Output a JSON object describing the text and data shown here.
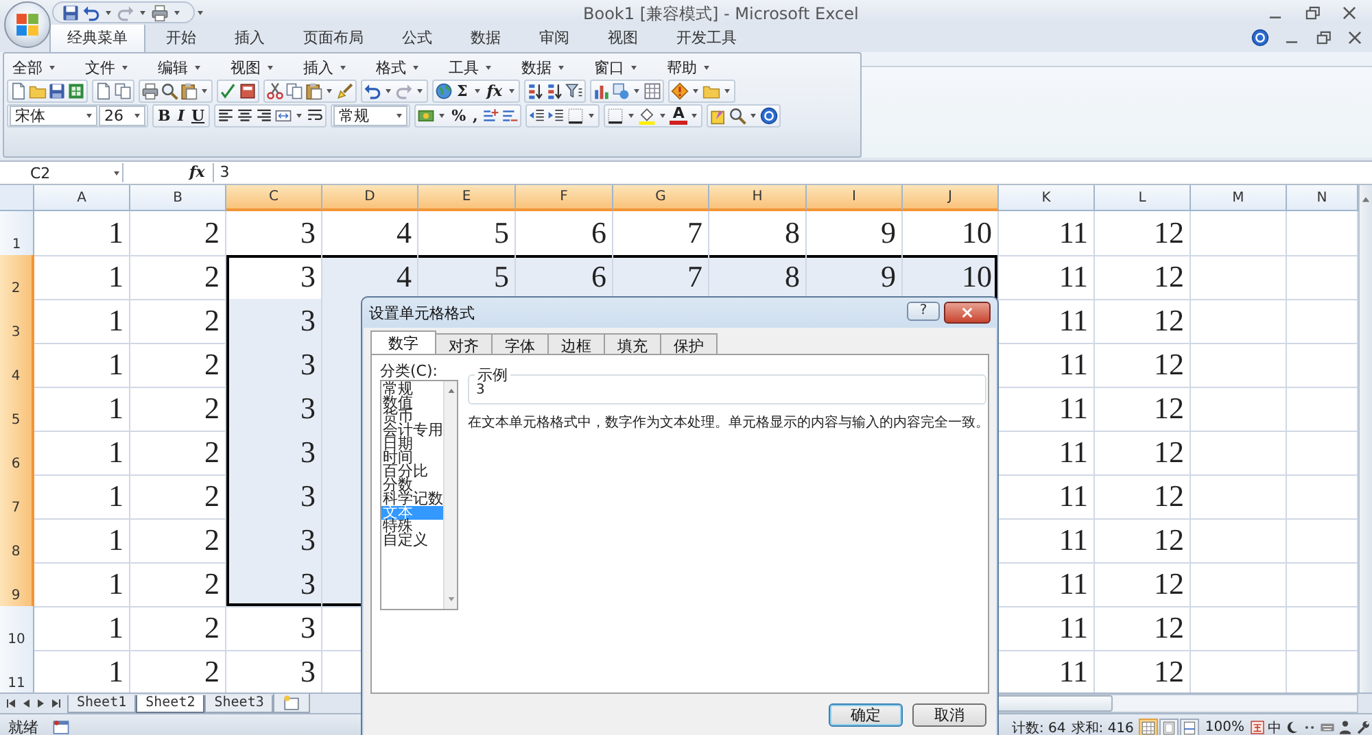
{
  "window": {
    "title": "Book1  [兼容模式] - Microsoft Excel"
  },
  "ribbon_tabs": [
    {
      "label": "经典菜单",
      "selected": true
    },
    {
      "label": "开始",
      "selected": false
    },
    {
      "label": "插入",
      "selected": false
    },
    {
      "label": "页面布局",
      "selected": false
    },
    {
      "label": "公式",
      "selected": false
    },
    {
      "label": "数据",
      "selected": false
    },
    {
      "label": "审阅",
      "selected": false
    },
    {
      "label": "视图",
      "selected": false
    },
    {
      "label": "开发工具",
      "selected": false
    }
  ],
  "classic_menus": [
    "全部",
    "文件",
    "编辑",
    "视图",
    "插入",
    "格式",
    "工具",
    "数据",
    "窗口",
    "帮助"
  ],
  "toolbar": {
    "sum": "Σ",
    "fx": "fx",
    "font": "宋体",
    "size": "26",
    "bold": "B",
    "italic": "I",
    "underline": "U",
    "number_format": "常规",
    "percent": "%",
    "comma": ",",
    "font_color": "A"
  },
  "formula_bar": {
    "name_box": "C2",
    "fx": "fx",
    "value": "3"
  },
  "sheet": {
    "columns": [
      {
        "label": "A",
        "selected": false
      },
      {
        "label": "B",
        "selected": false
      },
      {
        "label": "C",
        "selected": true
      },
      {
        "label": "D",
        "selected": true
      },
      {
        "label": "E",
        "selected": true
      },
      {
        "label": "F",
        "selected": true
      },
      {
        "label": "G",
        "selected": true
      },
      {
        "label": "H",
        "selected": true
      },
      {
        "label": "I",
        "selected": true
      },
      {
        "label": "J",
        "selected": true
      },
      {
        "label": "K",
        "selected": false
      },
      {
        "label": "L",
        "selected": false
      },
      {
        "label": "M",
        "selected": false
      },
      {
        "label": "N",
        "selected": false
      }
    ],
    "rows": [
      {
        "label": "1",
        "selected": false,
        "cells": [
          "1",
          "2",
          "3",
          "4",
          "5",
          "6",
          "7",
          "8",
          "9",
          "10",
          "11",
          "12",
          null,
          null
        ]
      },
      {
        "label": "2",
        "selected": true,
        "cells": [
          "1",
          "2",
          "3",
          "4",
          "5",
          "6",
          "7",
          "8",
          "9",
          "10",
          "11",
          "12",
          null,
          null
        ]
      },
      {
        "label": "3",
        "selected": true,
        "cells": [
          "1",
          "2",
          "3",
          null,
          null,
          null,
          null,
          null,
          null,
          null,
          "11",
          "12",
          null,
          null
        ]
      },
      {
        "label": "4",
        "selected": true,
        "cells": [
          "1",
          "2",
          "3",
          null,
          null,
          null,
          null,
          null,
          null,
          null,
          "11",
          "12",
          null,
          null
        ]
      },
      {
        "label": "5",
        "selected": true,
        "cells": [
          "1",
          "2",
          "3",
          null,
          null,
          null,
          null,
          null,
          null,
          null,
          "11",
          "12",
          null,
          null
        ]
      },
      {
        "label": "6",
        "selected": true,
        "cells": [
          "1",
          "2",
          "3",
          null,
          null,
          null,
          null,
          null,
          null,
          null,
          "11",
          "12",
          null,
          null
        ]
      },
      {
        "label": "7",
        "selected": true,
        "cells": [
          "1",
          "2",
          "3",
          null,
          null,
          null,
          null,
          null,
          null,
          null,
          "11",
          "12",
          null,
          null
        ]
      },
      {
        "label": "8",
        "selected": true,
        "cells": [
          "1",
          "2",
          "3",
          null,
          null,
          null,
          null,
          null,
          null,
          null,
          "11",
          "12",
          null,
          null
        ]
      },
      {
        "label": "9",
        "selected": true,
        "cells": [
          "1",
          "2",
          "3",
          null,
          null,
          null,
          null,
          null,
          null,
          null,
          "11",
          "12",
          null,
          null
        ]
      },
      {
        "label": "10",
        "selected": false,
        "cells": [
          "1",
          "2",
          "3",
          null,
          null,
          null,
          null,
          null,
          null,
          null,
          "11",
          "12",
          null,
          null
        ]
      },
      {
        "label": "11",
        "selected": false,
        "cells": [
          "1",
          "2",
          "3",
          null,
          null,
          null,
          null,
          null,
          null,
          null,
          "11",
          "12",
          null,
          null
        ]
      }
    ]
  },
  "sheet_tabs": [
    {
      "label": "Sheet1",
      "selected": false
    },
    {
      "label": "Sheet2",
      "selected": true
    },
    {
      "label": "Sheet3",
      "selected": false
    }
  ],
  "status_bar": {
    "state": "就绪",
    "count": "计数: 64",
    "sum": "求和: 416",
    "views": [
      {
        "selected": true
      },
      {
        "selected": false
      },
      {
        "selected": false
      }
    ],
    "zoom": "100%",
    "ime": "中"
  },
  "dialog": {
    "title": "设置单元格格式",
    "help": "?",
    "tabs": [
      {
        "label": "数字",
        "selected": true
      },
      {
        "label": "对齐",
        "selected": false
      },
      {
        "label": "字体",
        "selected": false
      },
      {
        "label": "边框",
        "selected": false
      },
      {
        "label": "填充",
        "selected": false
      },
      {
        "label": "保护",
        "selected": false
      }
    ],
    "category_label": "分类(C):",
    "categories": [
      {
        "label": "常规",
        "selected": false
      },
      {
        "label": "数值",
        "selected": false
      },
      {
        "label": "货币",
        "selected": false
      },
      {
        "label": "会计专用",
        "selected": false
      },
      {
        "label": "日期",
        "selected": false
      },
      {
        "label": "时间",
        "selected": false
      },
      {
        "label": "百分比",
        "selected": false
      },
      {
        "label": "分数",
        "selected": false
      },
      {
        "label": "科学记数",
        "selected": false
      },
      {
        "label": "文本",
        "selected": true
      },
      {
        "label": "特殊",
        "selected": false
      },
      {
        "label": "自定义",
        "selected": false
      }
    ],
    "sample_label": "示例",
    "sample_value": "3",
    "description": "在文本单元格格式中，数字作为文本处理。单元格显示的内容与输入的内容完全一致。",
    "buttons": [
      {
        "label": "确定",
        "default": true
      },
      {
        "label": "取消",
        "default": false
      }
    ]
  }
}
